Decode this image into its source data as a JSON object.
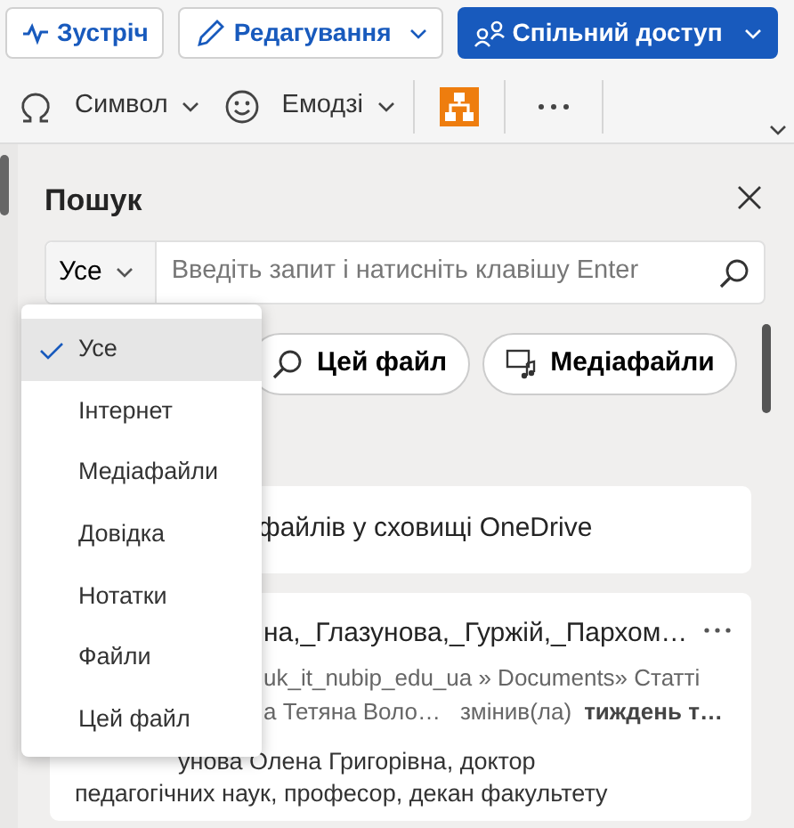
{
  "toolbar": {
    "buttons": [
      {
        "label": "Зустріч",
        "kind": "meeting"
      },
      {
        "label": "Редагування",
        "kind": "edit"
      },
      {
        "label": "Спільний доступ",
        "kind": "share"
      }
    ],
    "ribbon": [
      {
        "label": "Символ",
        "kind": "symbol"
      },
      {
        "label": "Емодзі",
        "kind": "emoji"
      },
      {
        "kind": "diagram"
      },
      {
        "kind": "more"
      }
    ]
  },
  "search": {
    "title": "Пошук",
    "scope": "Усе",
    "placeholder": "Введіть запит і натисніть клавішу Enter",
    "chips": [
      {
        "label": "Цей файл",
        "kind": "file"
      },
      {
        "label": "Медіафайли",
        "kind": "media"
      }
    ],
    "scope_menu": [
      {
        "label": "Усе",
        "selected": true
      },
      {
        "label": "Інтернет",
        "selected": false
      },
      {
        "label": "Медіафайли",
        "selected": false
      },
      {
        "label": "Довідка",
        "selected": false
      },
      {
        "label": "Нотатки",
        "selected": false
      },
      {
        "label": "Файли",
        "selected": false
      },
      {
        "label": "Цей файл",
        "selected": false
      }
    ],
    "results": [
      {
        "kind": "info",
        "text": "файлів у сховищі OneDrive"
      },
      {
        "kind": "file",
        "title": "на,_Глазунова,_Гуржій,_Пархом…",
        "path": "uk_it_nubip_edu_ua » Documents» Статті",
        "author": "а Тетяна Воло…",
        "action": "змінив(ла)",
        "when": "тиждень т…",
        "snippet": [
          "унова Олена Григорівна, доктор",
          "педагогічних наук, професор, декан факультету"
        ]
      }
    ]
  }
}
